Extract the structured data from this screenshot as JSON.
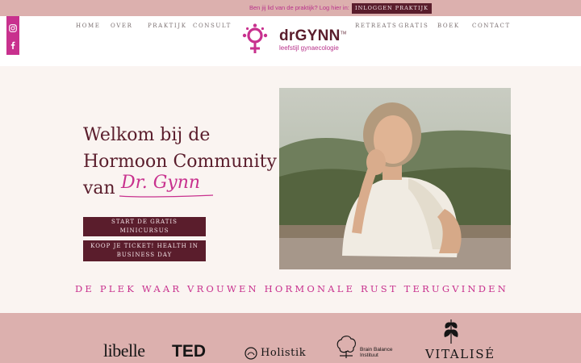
{
  "topbar": {
    "member_text": "Ben jij lid van de praktijk? Log hier in:",
    "login_button": "INLOGGEN PRAKTIJK"
  },
  "social": {
    "icons": [
      "instagram-icon",
      "facebook-icon"
    ]
  },
  "nav": {
    "home": "HOME",
    "over": "OVER",
    "praktijk": "PRAKTIJK",
    "consult": "CONSULT",
    "retreats": "RETREATS",
    "gratis": "GRATIS",
    "boek": "BOEK",
    "contact": "CONTACT"
  },
  "logo": {
    "name": "drGYNN",
    "tagline": "leefstijl gynaecologie"
  },
  "hero": {
    "line1": "Welkom bij de",
    "line2": "Hormoon Community",
    "line3": "van",
    "signature": "Dr. Gynn",
    "button1": "START DE GRATIS MINICURSUS",
    "button2": "KOOP JE TICKET! HEALTH IN BUSINESS DAY"
  },
  "tagline": "DE PLEK WAAR VROUWEN HORMONALE RUST TERUGVINDEN",
  "press": {
    "libelle": "libelle",
    "ted": "TED",
    "holistik": "Holistik",
    "brain_balance": "Brain Balance Instituut",
    "vitalise": "VITALISÉ"
  },
  "colors": {
    "accent": "#c8318e",
    "dark": "#5a1d2c",
    "rose": "#dcb0ae",
    "cream": "#faf4f1"
  }
}
